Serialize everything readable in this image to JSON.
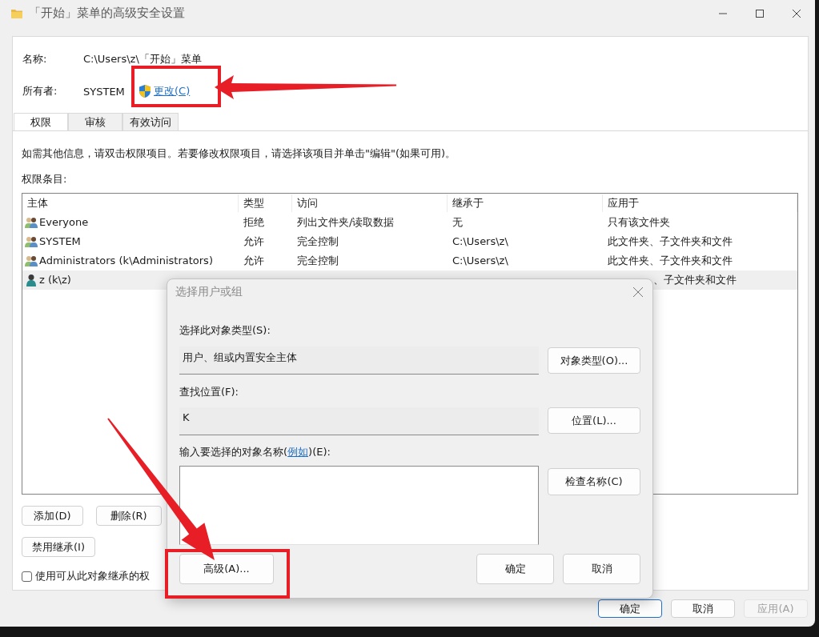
{
  "window": {
    "title": "「开始」菜单的高级安全设置"
  },
  "name_field": {
    "label": "名称:",
    "value": "C:\\Users\\z\\「开始」菜单"
  },
  "owner_field": {
    "label": "所有者:",
    "value": "SYSTEM",
    "change_link": "更改(C)"
  },
  "tabs": [
    {
      "label": "权限",
      "selected": true
    },
    {
      "label": "审核",
      "selected": false
    },
    {
      "label": "有效访问",
      "selected": false
    }
  ],
  "info_text": "如需其他信息，请双击权限项目。若要修改权限项目，请选择该项目并单击\"编辑\"(如果可用)。",
  "entries_label": "权限条目:",
  "table": {
    "columns": [
      "主体",
      "类型",
      "访问",
      "继承于",
      "应用于"
    ],
    "rows": [
      {
        "kind": "group",
        "selected": false,
        "principal": "Everyone",
        "type": "拒绝",
        "access": "列出文件夹/读取数据",
        "inherited_from": "无",
        "applies_to": "只有该文件夹"
      },
      {
        "kind": "group",
        "selected": false,
        "principal": "SYSTEM",
        "type": "允许",
        "access": "完全控制",
        "inherited_from": "C:\\Users\\z\\",
        "applies_to": "此文件夹、子文件夹和文件"
      },
      {
        "kind": "group",
        "selected": false,
        "principal": "Administrators (k\\Administrators)",
        "type": "允许",
        "access": "完全控制",
        "inherited_from": "C:\\Users\\z\\",
        "applies_to": "此文件夹、子文件夹和文件"
      },
      {
        "kind": "user",
        "selected": true,
        "principal": "z (k\\z)",
        "applies_to": "、子文件夹和文件"
      }
    ]
  },
  "entry_buttons": [
    "添加(D)",
    "删除(R)"
  ],
  "inherit_button": "禁用继承(I)",
  "inherit_checkbox": {
    "label": "使用可从此对象继承的权",
    "checked": false
  },
  "footer_buttons": [
    {
      "label": "确定",
      "default": true,
      "disabled": false
    },
    {
      "label": "取消",
      "default": false,
      "disabled": false
    },
    {
      "label": "应用(A)",
      "default": false,
      "disabled": true
    }
  ],
  "dialog": {
    "title": "选择用户或组",
    "object_type": {
      "label": "选择此对象类型(S):",
      "value": "用户、组或内置安全主体",
      "button": "对象类型(O)..."
    },
    "location": {
      "label": "查找位置(F):",
      "value": "K",
      "button": "位置(L)..."
    },
    "names": {
      "label_before": "输入要选择的对象名称(",
      "link": "例如",
      "label_after": ")(E):",
      "button": "检查名称(C)"
    },
    "advanced_button": "高级(A)...",
    "ok_button": "确定",
    "cancel_button": "取消"
  },
  "annotations": [
    {
      "kind": "box"
    },
    {
      "kind": "arrow"
    },
    {
      "kind": "box"
    },
    {
      "kind": "arrow"
    }
  ]
}
